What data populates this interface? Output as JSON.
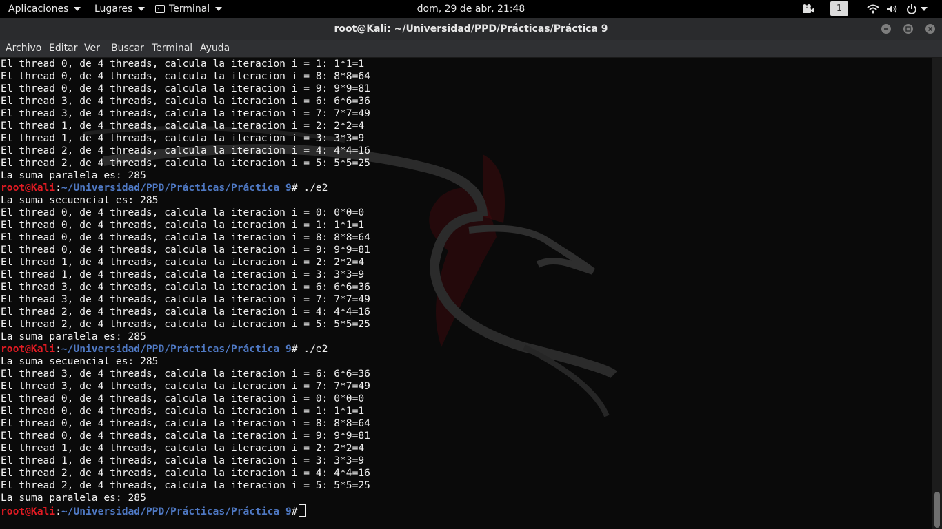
{
  "topbar": {
    "apps_label": "Aplicaciones",
    "places_label": "Lugares",
    "terminal_label": "Terminal",
    "clock": "dom, 29 de abr, 21:48",
    "workspace": "1"
  },
  "window": {
    "title": "root@Kali: ~/Universidad/PPD/Prácticas/Práctica 9"
  },
  "menubar": {
    "items": [
      "Archivo",
      "Editar",
      "Ver",
      "Buscar",
      "Terminal",
      "Ayuda"
    ]
  },
  "terminal": {
    "prompt_user": "root@Kali",
    "prompt_colon": ":",
    "prompt_path": "~/Universidad/PPD/Prácticas/Práctica 9",
    "lines": [
      "El thread 0, de 4 threads, calcula la iteracion i = 1: 1*1=1",
      "El thread 0, de 4 threads, calcula la iteracion i = 8: 8*8=64",
      "El thread 0, de 4 threads, calcula la iteracion i = 9: 9*9=81",
      "El thread 3, de 4 threads, calcula la iteracion i = 6: 6*6=36",
      "El thread 3, de 4 threads, calcula la iteracion i = 7: 7*7=49",
      "El thread 1, de 4 threads, calcula la iteracion i = 2: 2*2=4",
      "El thread 1, de 4 threads, calcula la iteracion i = 3: 3*3=9",
      "El thread 2, de 4 threads, calcula la iteracion i = 4: 4*4=16",
      "El thread 2, de 4 threads, calcula la iteracion i = 5: 5*5=25",
      "La suma paralela es: 285",
      "# ./e2",
      "La suma secuencial es: 285",
      "El thread 0, de 4 threads, calcula la iteracion i = 0: 0*0=0",
      "El thread 0, de 4 threads, calcula la iteracion i = 1: 1*1=1",
      "El thread 0, de 4 threads, calcula la iteracion i = 8: 8*8=64",
      "El thread 0, de 4 threads, calcula la iteracion i = 9: 9*9=81",
      "El thread 1, de 4 threads, calcula la iteracion i = 2: 2*2=4",
      "El thread 1, de 4 threads, calcula la iteracion i = 3: 3*3=9",
      "El thread 3, de 4 threads, calcula la iteracion i = 6: 6*6=36",
      "El thread 3, de 4 threads, calcula la iteracion i = 7: 7*7=49",
      "El thread 2, de 4 threads, calcula la iteracion i = 4: 4*4=16",
      "El thread 2, de 4 threads, calcula la iteracion i = 5: 5*5=25",
      "La suma paralela es: 285",
      "# ./e2",
      "La suma secuencial es: 285",
      "El thread 3, de 4 threads, calcula la iteracion i = 6: 6*6=36",
      "El thread 3, de 4 threads, calcula la iteracion i = 7: 7*7=49",
      "El thread 0, de 4 threads, calcula la iteracion i = 0: 0*0=0",
      "El thread 0, de 4 threads, calcula la iteracion i = 1: 1*1=1",
      "El thread 0, de 4 threads, calcula la iteracion i = 8: 8*8=64",
      "El thread 0, de 4 threads, calcula la iteracion i = 9: 9*9=81",
      "El thread 1, de 4 threads, calcula la iteracion i = 2: 2*2=4",
      "El thread 1, de 4 threads, calcula la iteracion i = 3: 3*3=9",
      "El thread 2, de 4 threads, calcula la iteracion i = 4: 4*4=16",
      "El thread 2, de 4 threads, calcula la iteracion i = 5: 5*5=25",
      "La suma paralela es: 285",
      "#"
    ]
  },
  "colors": {
    "prompt_user": "#e31b23",
    "prompt_path": "#4f79c4",
    "terminal_bg": "#0a0a0a"
  }
}
